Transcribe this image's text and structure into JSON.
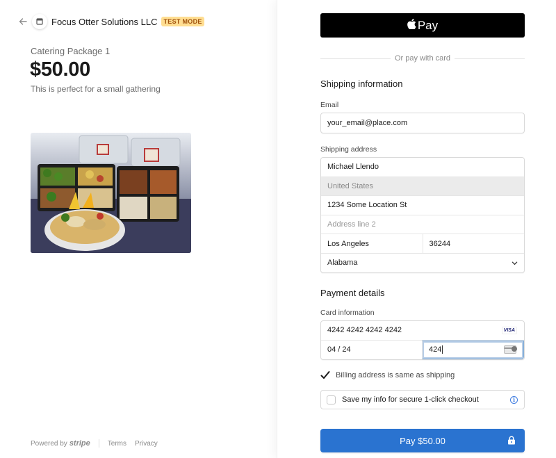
{
  "merchant": {
    "name": "Focus Otter Solutions LLC",
    "badge": "TEST MODE"
  },
  "product": {
    "name": "Catering Package 1",
    "price": "$50.00",
    "description": "This is perfect for a small gathering"
  },
  "footer": {
    "powered_by": "Powered by",
    "brand": "stripe",
    "terms": "Terms",
    "privacy": "Privacy"
  },
  "apple_pay": {
    "label": "Pay"
  },
  "divider": "Or pay with card",
  "shipping": {
    "title": "Shipping information",
    "email_label": "Email",
    "email": "your_email@place.com",
    "address_label": "Shipping address",
    "name": "Michael Llendo",
    "country": "United States",
    "line1": "1234 Some Location St",
    "line2_placeholder": "Address line 2",
    "city": "Los Angeles",
    "zip": "36244",
    "state": "Alabama"
  },
  "payment": {
    "title": "Payment details",
    "card_label": "Card information",
    "card_number": "4242 4242 4242 4242",
    "card_brand": "VISA",
    "expiry": "04 / 24",
    "cvc": "424",
    "billing_same": "Billing address is same as shipping",
    "save_info": "Save my info for secure 1-click checkout"
  },
  "pay_button": "Pay $50.00",
  "colors": {
    "accent": "#2a73d0",
    "badge_bg": "#ffde92",
    "badge_text": "#a0510d"
  }
}
